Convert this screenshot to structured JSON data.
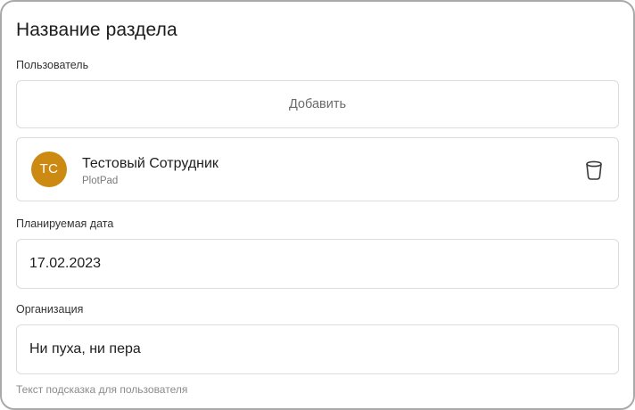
{
  "section": {
    "title": "Название раздела"
  },
  "user_field": {
    "label": "Пользователь",
    "add_label": "Добавить",
    "user": {
      "initials": "ТС",
      "name": "Тестовый Сотрудник",
      "organization": "PlotPad",
      "avatar_color": "#cc8a12",
      "delete_icon": "trash-icon"
    }
  },
  "date_field": {
    "label": "Планируемая дата",
    "value": "17.02.2023"
  },
  "organization_field": {
    "label": "Организация",
    "value": "Ни пуха, ни пера",
    "hint": "Текст подсказка для пользователя"
  }
}
